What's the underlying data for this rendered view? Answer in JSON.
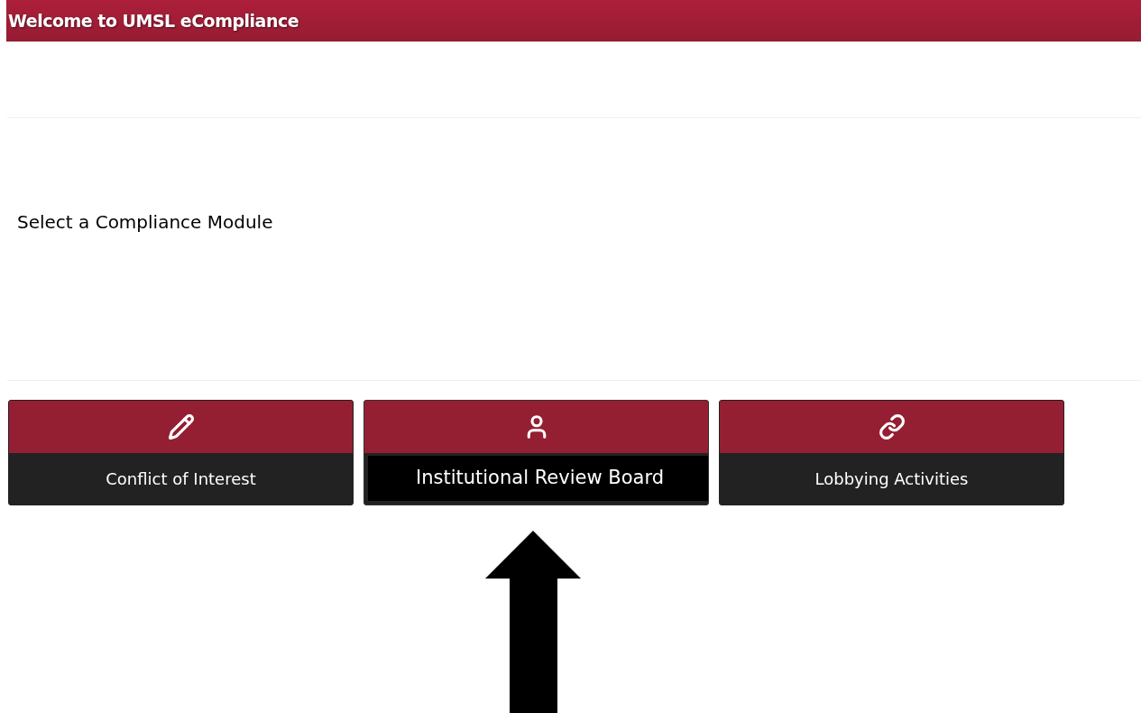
{
  "header": {
    "title": "Welcome to UMSL eCompliance"
  },
  "prompt": "Select a Compliance Module",
  "modules": [
    {
      "kind": "pencil",
      "label": "Conflict of Interest",
      "selected": false
    },
    {
      "kind": "user",
      "label": "Institutional Review Board",
      "selected": true
    },
    {
      "kind": "link",
      "label": "Lobbying Activities",
      "selected": false
    }
  ]
}
